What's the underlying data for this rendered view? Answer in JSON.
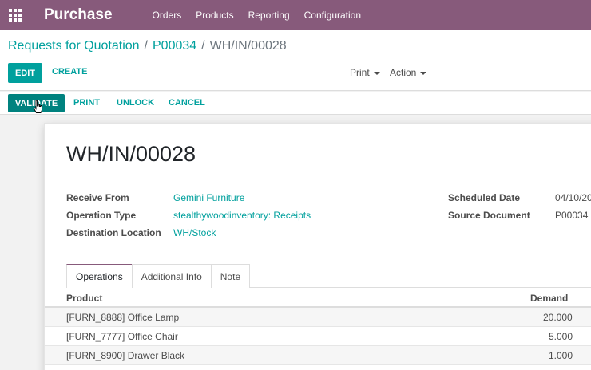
{
  "navbar": {
    "app_name": "Purchase",
    "menu": [
      "Orders",
      "Products",
      "Reporting",
      "Configuration"
    ],
    "bg_color": "#875a7b",
    "apps_icon": "grid-icon"
  },
  "breadcrumb": {
    "items": [
      "Requests for Quotation",
      "P00034"
    ],
    "separator": "/",
    "current": "WH/IN/00028"
  },
  "control": {
    "edit_label": "EDIT",
    "create_label": "CREATE",
    "print_label": "Print",
    "action_label": "Action"
  },
  "statusbar": {
    "validate_label": "VALIDATE",
    "print_label": "PRINT",
    "unlock_label": "UNLOCK",
    "cancel_label": "CANCEL"
  },
  "form": {
    "title": "WH/IN/00028",
    "fields_left": [
      {
        "label": "Receive From",
        "value": "Gemini Furniture"
      },
      {
        "label": "Operation Type",
        "value": "stealthywoodinventory: Receipts"
      },
      {
        "label": "Destination Location",
        "value": "WH/Stock"
      }
    ],
    "fields_right": [
      {
        "label": "Scheduled Date",
        "value": "04/10/20"
      },
      {
        "label": "Source Document",
        "value": "P00034"
      }
    ]
  },
  "tabs": [
    "Operations",
    "Additional Info",
    "Note"
  ],
  "table": {
    "columns": [
      "Product",
      "Demand"
    ],
    "rows": [
      {
        "product": "[FURN_8888] Office Lamp",
        "demand": "20.000"
      },
      {
        "product": "[FURN_7777] Office Chair",
        "demand": "5.000"
      },
      {
        "product": "[FURN_8900] Drawer Black",
        "demand": "1.000"
      }
    ]
  },
  "colors": {
    "primary": "#00a09d",
    "validate": "#00827f",
    "brand": "#875a7b"
  }
}
